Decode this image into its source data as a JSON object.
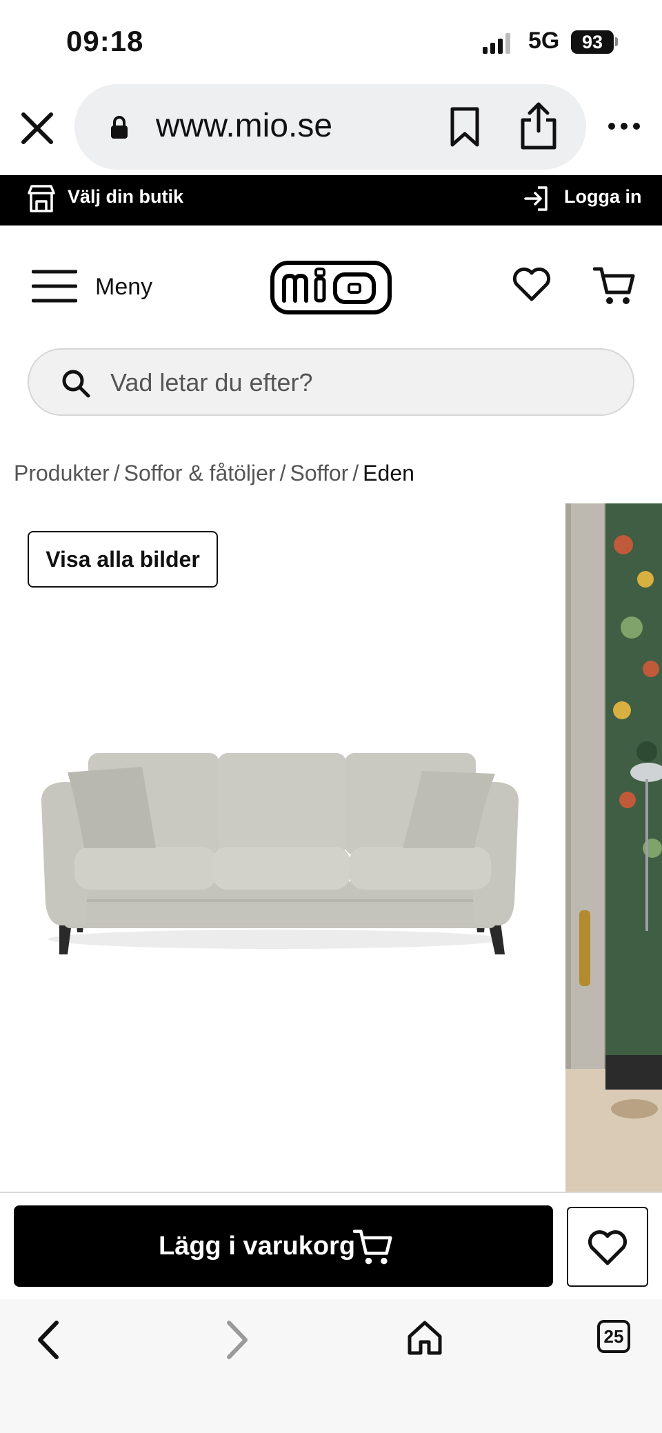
{
  "status_bar": {
    "time": "09:18",
    "network": "5G",
    "battery": "93"
  },
  "browser": {
    "url": "www.mio.se",
    "tab_count": "25"
  },
  "topbar": {
    "store_label": "Välj din butik",
    "login_label": "Logga in"
  },
  "header": {
    "menu_label": "Meny",
    "logo_text": "mio"
  },
  "search": {
    "placeholder": "Vad letar du efter?"
  },
  "breadcrumb": [
    {
      "label": "Produkter"
    },
    {
      "label": "Soffor & fåtöljer"
    },
    {
      "label": "Soffor"
    },
    {
      "label": "Eden"
    }
  ],
  "gallery": {
    "show_all_label": "Visa alla bilder"
  },
  "cta": {
    "add_to_cart_label": "Lägg i varukorg"
  },
  "colors": {
    "brand_black": "#000000",
    "sofa_fabric": "#cdccc5",
    "page_bg": "#ffffff"
  },
  "icons": {
    "close": "close-icon",
    "lock": "lock-icon",
    "bookmark": "bookmark-icon",
    "share": "share-icon",
    "more": "more-icon",
    "store": "store-icon",
    "login": "login-icon",
    "menu": "menu-icon",
    "heart": "heart-icon",
    "cart": "cart-icon",
    "search": "search-icon",
    "back": "chevron-left-icon",
    "forward": "chevron-right-icon",
    "home": "home-icon"
  }
}
